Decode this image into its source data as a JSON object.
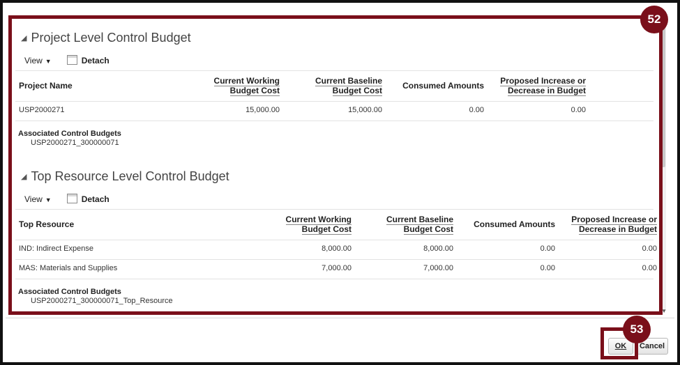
{
  "project_section": {
    "title": "Project Level Control Budget",
    "view_label": "View",
    "detach_label": "Detach",
    "columns": {
      "name": "Project Name",
      "working_1": "Current Working",
      "working_2": "Budget Cost",
      "baseline_1": "Current Baseline",
      "baseline_2": "Budget Cost",
      "consumed": "Consumed Amounts",
      "proposed_1": "Proposed Increase or",
      "proposed_2": "Decrease in Budget"
    },
    "rows": [
      {
        "name": "USP2000271",
        "working": "15,000.00",
        "baseline": "15,000.00",
        "consumed": "0.00",
        "proposed": "0.00"
      }
    ],
    "assoc_label": "Associated Control Budgets",
    "assoc_value": "USP2000271_300000071"
  },
  "resource_section": {
    "title": "Top Resource Level Control Budget",
    "view_label": "View",
    "detach_label": "Detach",
    "columns": {
      "name": "Top Resource",
      "working_1": "Current Working",
      "working_2": "Budget Cost",
      "baseline_1": "Current Baseline",
      "baseline_2": "Budget Cost",
      "consumed": "Consumed Amounts",
      "proposed_1": "Proposed Increase or",
      "proposed_2": "Decrease in Budget"
    },
    "rows": [
      {
        "name": "IND: Indirect Expense",
        "working": "8,000.00",
        "baseline": "8,000.00",
        "consumed": "0.00",
        "proposed": "0.00"
      },
      {
        "name": "MAS: Materials and Supplies",
        "working": "7,000.00",
        "baseline": "7,000.00",
        "consumed": "0.00",
        "proposed": "0.00"
      }
    ],
    "assoc_label": "Associated Control Budgets",
    "assoc_value": "USP2000271_300000071_Top_Resource"
  },
  "footer": {
    "ok_label": "OK",
    "cancel_label": "Cancel"
  },
  "annotations": {
    "step_52": "52",
    "step_53": "53",
    "color": "#7a0f1a"
  },
  "icons": {
    "section_toggle": "triangle-down-left-icon",
    "view_menu": "caret-down-icon",
    "detach": "detach-window-icon"
  }
}
